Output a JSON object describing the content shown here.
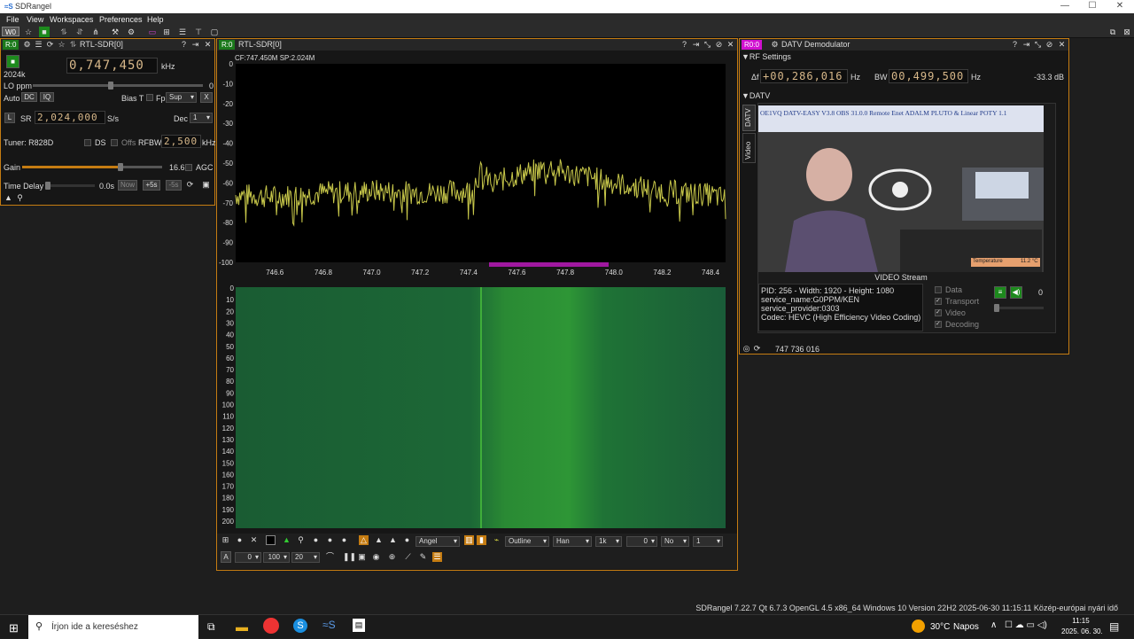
{
  "window": {
    "title": "SDRangel",
    "minimize": "—",
    "maximize": "☐",
    "close": "✕"
  },
  "menu": [
    "File",
    "View",
    "Workspaces",
    "Preferences",
    "Help"
  ],
  "workspace_tag": "W0",
  "device": {
    "tag": "R:0",
    "name": "RTL-SDR[0]",
    "sample_rate_label": "2024k",
    "center_freq": "0,747,450",
    "freq_unit": "kHz",
    "lo_ppm_label": "LO ppm",
    "lo_ppm_value": "0",
    "auto_label": "Auto",
    "dc_label": "DC",
    "iq_label": "IQ",
    "bias_t_label": "Bias T",
    "fp_label": "Fp",
    "sup_value": "Sup",
    "x_label": "X",
    "l_label": "L",
    "sr_label": "SR",
    "sr_value": "2,024,000",
    "sr_unit": "S/s",
    "dec_label": "Dec",
    "dec_value": "1",
    "tuner_label": "Tuner: R828D",
    "ds_label": "DS",
    "offs_label": "Offs",
    "rfbw_label": "RFBW",
    "rfbw_value": "2,500",
    "rfbw_unit": "kHz",
    "gain_label": "Gain",
    "gain_value": "16.6",
    "gain_level": 0.7,
    "agc_label": "AGC",
    "time_delay_label": "Time Delay",
    "time_delay_value": "0.0s",
    "now_label": "Now",
    "plus5_label": "+5s",
    "minus5_label": "-5s"
  },
  "spectrum": {
    "tag": "R:0",
    "name": "RTL-SDR[0]",
    "info": "CF:747.450M SP:2.024M",
    "window_combo": "Angel",
    "mode_combo": "Outline",
    "fft_window": "Han",
    "fft_size": "1k",
    "avg_value": "0",
    "no_combo": "No",
    "ratio_combo": "1",
    "a_label": "A",
    "ref_value": "0",
    "range_value": "100",
    "step_value": "20"
  },
  "chart_data": [
    {
      "type": "line",
      "title": "",
      "xlabel": "",
      "ylabel": "",
      "x_ticks": [
        "746.6",
        "746.8",
        "747.0",
        "747.2",
        "747.4",
        "747.6",
        "747.8",
        "748.0",
        "748.2",
        "748.4"
      ],
      "y_ticks": [
        "0",
        "-10",
        "-20",
        "-30",
        "-40",
        "-50",
        "-60",
        "-70",
        "-80",
        "-90",
        "-100"
      ],
      "xlim": [
        746.438,
        748.462
      ],
      "ylim": [
        -100,
        0
      ],
      "series": [
        {
          "color": "#c8c84a",
          "x": [
            746.45,
            746.6,
            746.8,
            747.0,
            747.2,
            747.4,
            747.45,
            747.5,
            747.6,
            747.7,
            747.75,
            747.8,
            747.9,
            748.0,
            748.2,
            748.4,
            748.46
          ],
          "y": [
            -66,
            -67,
            -65,
            -64,
            -65,
            -64,
            -55,
            -60,
            -56,
            -53,
            -52,
            -55,
            -57,
            -60,
            -64,
            -66,
            -68
          ]
        }
      ]
    },
    {
      "type": "heatmap",
      "title": "",
      "y_ticks": [
        "0",
        "10",
        "20",
        "30",
        "40",
        "50",
        "60",
        "70",
        "80",
        "90",
        "100",
        "110",
        "120",
        "130",
        "140",
        "150",
        "160",
        "170",
        "180",
        "190",
        "200"
      ]
    }
  ],
  "datv": {
    "tag": "R0:0",
    "name": "DATV Demodulator",
    "rf_settings_label": "▼RF Settings",
    "delta_label": "Δf",
    "delta_value": "+00,286,016",
    "delta_unit": "Hz",
    "bw_label": "BW",
    "bw_value": "00,499,500",
    "bw_unit": "Hz",
    "power": "-33.3 dB",
    "section_label": "▼DATV",
    "tab_datv": "DATV",
    "tab_video": "Video",
    "video_caption": "OE1VQ DATV-EASY  V3.8 OBS 31.0.0  Remote Enet ADALM PLUTO & Linear POTY 1.1",
    "temperature_label": "Temperature",
    "temperature_value": "11.2 °C",
    "video_stream_label": "VIDEO Stream",
    "info_lines": [
      "PID: 256 - Width: 1920 - Height: 1080",
      "service_name:G0PPM/KEN",
      "service_provider:0303",
      "Codec: HEVC (High Efficiency Video Coding)"
    ],
    "checks": [
      "Data",
      "Transport",
      "Video",
      "Decoding"
    ],
    "audio_value": "0",
    "footer_freq": "747 736 016"
  },
  "statusbar": "SDRangel 7.22.7 Qt 6.7.3 OpenGL 4.5 x86_64 Windows 10 Version 22H2  2025-06-30 11:15:11 Közép-európai nyári idő",
  "taskbar": {
    "search_placeholder": "Írjon ide a kereséshez",
    "weather_temp": "30°C",
    "weather_text": "Napos",
    "time": "11:15",
    "date": "2025. 06. 30."
  }
}
